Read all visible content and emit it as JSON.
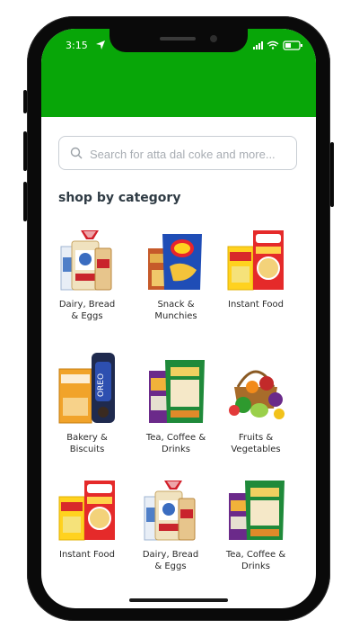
{
  "status_bar": {
    "time": "3:15"
  },
  "search": {
    "placeholder": "Search for atta dal coke and more..."
  },
  "section_title": "shop by category",
  "categories": [
    {
      "label_line1": "Dairy, Bread",
      "label_line2": "& Eggs",
      "icon": "dairy-bread-eggs-image"
    },
    {
      "label_line1": "Snack &",
      "label_line2": "Munchies",
      "icon": "snack-munchies-image"
    },
    {
      "label_line1": "Instant Food",
      "label_line2": "",
      "icon": "instant-food-image"
    },
    {
      "label_line1": "Bakery &",
      "label_line2": "Biscuits",
      "icon": "bakery-biscuits-image"
    },
    {
      "label_line1": "Tea, Coffee &",
      "label_line2": "Drinks",
      "icon": "tea-coffee-drinks-image"
    },
    {
      "label_line1": "Fruits &",
      "label_line2": "Vegetables",
      "icon": "fruits-vegetables-image"
    },
    {
      "label_line1": "Instant Food",
      "label_line2": "",
      "icon": "instant-food-image"
    },
    {
      "label_line1": "Dairy, Bread",
      "label_line2": "& Eggs",
      "icon": "dairy-bread-eggs-image"
    },
    {
      "label_line1": "Tea, Coffee &",
      "label_line2": "Drinks",
      "icon": "tea-coffee-drinks-image"
    }
  ],
  "colors": {
    "header": "#08a608",
    "title": "#2f3b44"
  }
}
